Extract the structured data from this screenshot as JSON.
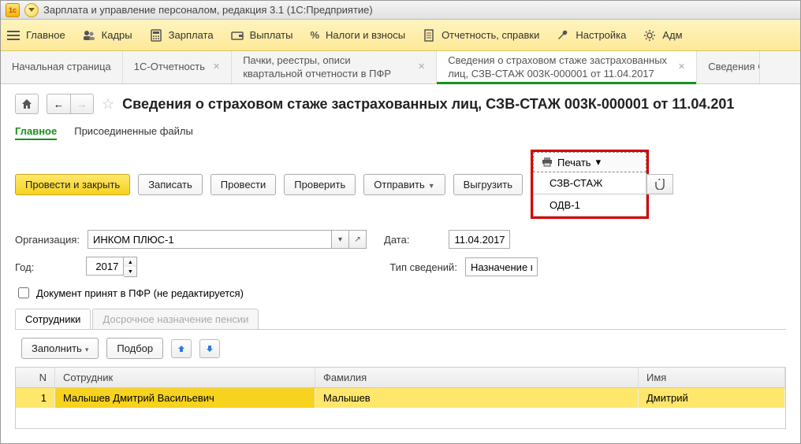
{
  "window": {
    "title": "Зарплата и управление персоналом, редакция 3.1  (1С:Предприятие)"
  },
  "mainmenu": {
    "items": [
      {
        "label": "Главное"
      },
      {
        "label": "Кадры"
      },
      {
        "label": "Зарплата"
      },
      {
        "label": "Выплаты"
      },
      {
        "label": "Налоги и взносы"
      },
      {
        "label": "Отчетность, справки"
      },
      {
        "label": "Настройка"
      },
      {
        "label": "Адм"
      }
    ]
  },
  "tabs": [
    {
      "label": "Начальная страница"
    },
    {
      "label": "1С-Отчетность"
    },
    {
      "label": "Пачки, реестры, описи квартальной отчетности в ПФР"
    },
    {
      "label": "Сведения о страховом стаже застрахованных лиц, СЗВ-СТАЖ 003К-000001 от 11.04.2017",
      "active": true
    },
    {
      "label": "Сведения СЗВ-СТА"
    }
  ],
  "page": {
    "title": "Сведения о страховом стаже застрахованных лиц, СЗВ-СТАЖ 003К-000001 от 11.04.201"
  },
  "subnav": {
    "main": "Главное",
    "attached": "Присоединенные файлы"
  },
  "toolbar": {
    "post_close": "Провести и закрыть",
    "save": "Записать",
    "post": "Провести",
    "check": "Проверить",
    "send": "Отправить",
    "export": "Выгрузить",
    "print": "Печать",
    "print_menu": {
      "szv_stazh": "СЗВ-СТАЖ",
      "odv1": "ОДВ-1"
    }
  },
  "form": {
    "org_label": "Организация:",
    "org_value": "ИНКОМ ПЛЮС-1",
    "date_label": "Дата:",
    "date_value": "11.04.2017",
    "year_label": "Год:",
    "year_value": "2017",
    "type_label": "Тип сведений:",
    "type_value": "Назначение п",
    "accepted_label": "Документ принят в ПФР (не редактируется)"
  },
  "doc_tabs": {
    "employees": "Сотрудники",
    "early": "Досрочное назначение пенсии"
  },
  "doc_toolbar": {
    "fill": "Заполнить",
    "pick": "Подбор"
  },
  "grid": {
    "headers": {
      "n": "N",
      "emp": "Сотрудник",
      "fam": "Фамилия",
      "name": "Имя"
    },
    "rows": [
      {
        "n": "1",
        "emp": "Малышев Дмитрий Васильевич",
        "fam": "Малышев",
        "name": "Дмитрий"
      }
    ]
  }
}
